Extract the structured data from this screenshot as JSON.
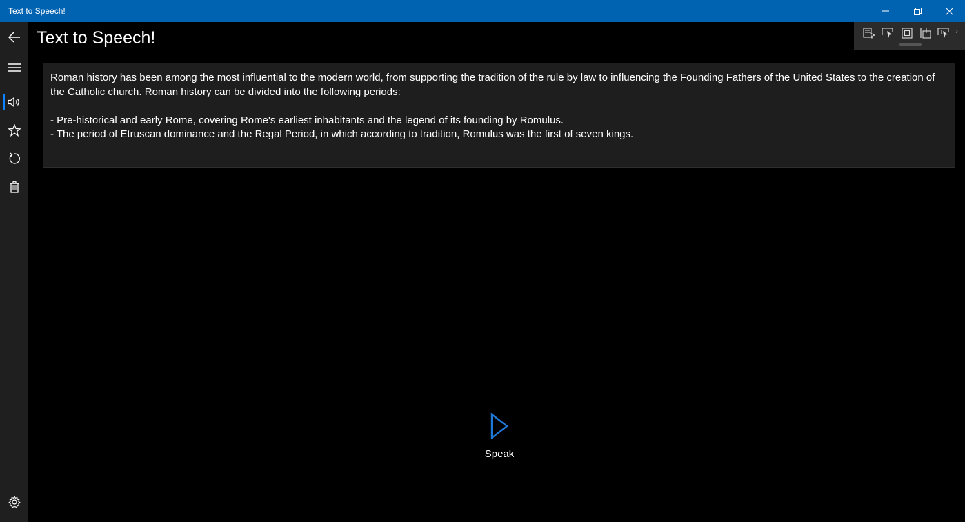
{
  "window": {
    "title": "Text to Speech!",
    "controls": [
      "minimize-icon",
      "restore-icon",
      "close-icon"
    ]
  },
  "colors": {
    "titlebar": "#0063b1",
    "accent": "#0a84ff",
    "rail": "#1f1f1f",
    "textbox": "#1e1e1e"
  },
  "nav": {
    "items": [
      {
        "icon": "back-arrow-icon"
      },
      {
        "icon": "hamburger-icon"
      },
      {
        "icon": "speaker-icon",
        "selected": true
      },
      {
        "icon": "star-icon"
      },
      {
        "icon": "refresh-icon"
      },
      {
        "icon": "trash-icon"
      },
      {
        "icon": "gear-icon"
      }
    ]
  },
  "page": {
    "title": "Text to Speech!"
  },
  "editor": {
    "text": "Roman history has been among the most influential to the modern world, from supporting the tradition of the rule by law to influencing the Founding Fathers of the United States to the creation of the Catholic church. Roman history can be divided into the following periods:\n\n- Pre-historical and early Rome, covering Rome's earliest inhabitants and the legend of its founding by Romulus.\n- The period of Etruscan dominance and the Regal Period, in which according to tradition, Romulus was the first of seven kings."
  },
  "devtools": {
    "icons": [
      "live-visual-tree-icon",
      "select-element-icon",
      "display-layout-adorners-icon",
      "track-focus-icon",
      "hot-reload-icon",
      "chevron-right-icon"
    ]
  },
  "speak": {
    "label": "Speak",
    "icon": "play-icon"
  }
}
